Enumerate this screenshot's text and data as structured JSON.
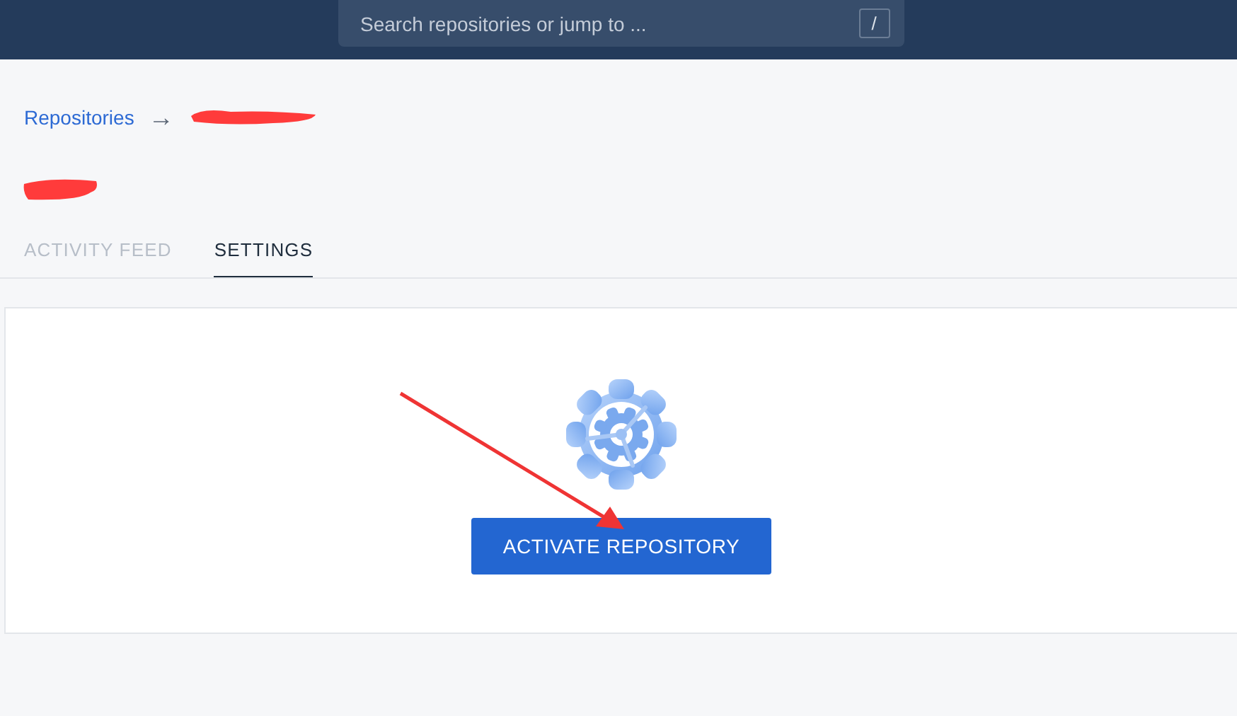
{
  "search": {
    "placeholder": "Search repositories or jump to ...",
    "shortcut_key": "/"
  },
  "breadcrumb": {
    "root": "Repositories",
    "separator": "→"
  },
  "tabs": [
    {
      "label": "ACTIVITY FEED",
      "selected": false
    },
    {
      "label": "SETTINGS",
      "selected": true
    }
  ],
  "card": {
    "button": "ACTIVATE REPOSITORY"
  }
}
